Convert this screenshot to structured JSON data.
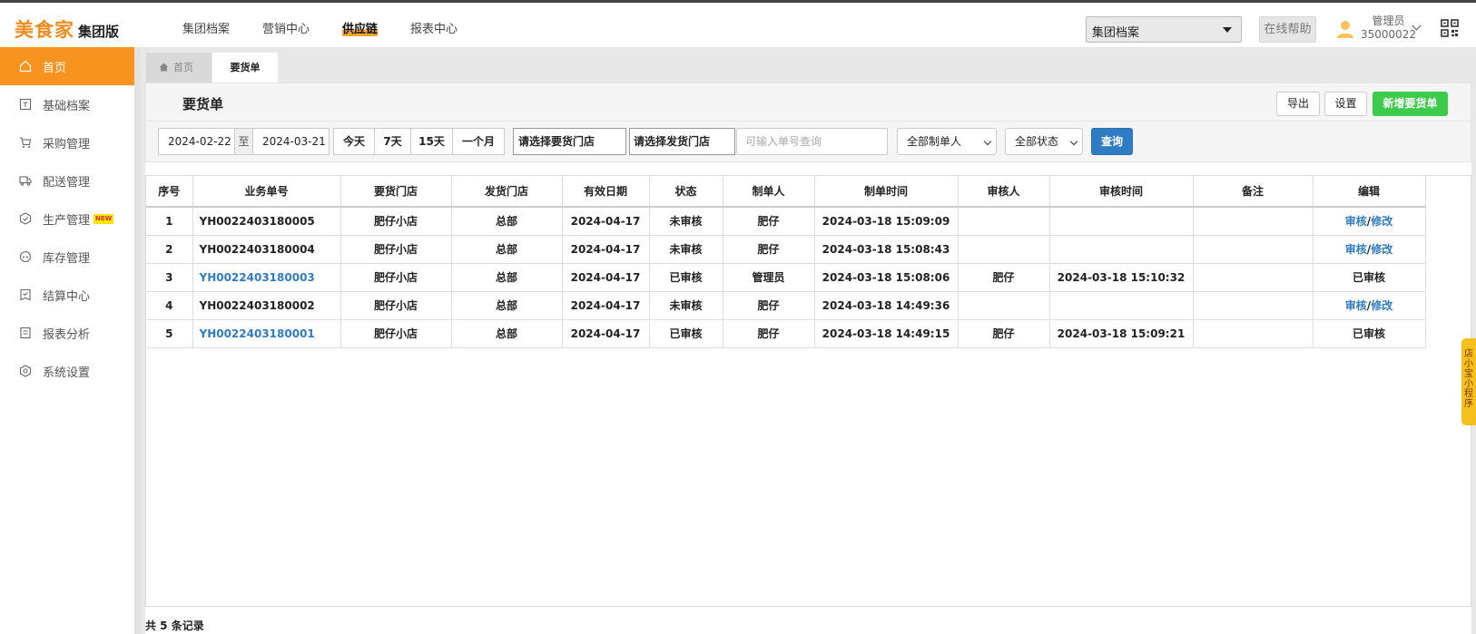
{
  "header": {
    "logo_brand": "美食家",
    "logo_edition": "集团版",
    "nav": [
      "集团档案",
      "营销中心",
      "供应链",
      "报表中心"
    ],
    "nav_active": "供应链",
    "group_select": "集团档案",
    "help": "在线帮助",
    "user_name": "管理员",
    "user_id": "35000022"
  },
  "sidebar": {
    "items": [
      {
        "label": "首页",
        "icon": "home-icon"
      },
      {
        "label": "基础档案",
        "icon": "archive-icon"
      },
      {
        "label": "采购管理",
        "icon": "cart-icon"
      },
      {
        "label": "配送管理",
        "icon": "truck-icon"
      },
      {
        "label": "生产管理",
        "icon": "production-icon",
        "badge": "NEW"
      },
      {
        "label": "库存管理",
        "icon": "warehouse-icon"
      },
      {
        "label": "结算中心",
        "icon": "settlement-icon"
      },
      {
        "label": "报表分析",
        "icon": "report-icon"
      },
      {
        "label": "系统设置",
        "icon": "settings-icon"
      }
    ]
  },
  "tabs": {
    "home": "首页",
    "current": "要货单"
  },
  "page": {
    "title": "要货单",
    "export": "导出",
    "settings": "设置",
    "new_order": "新增要货单"
  },
  "filters": {
    "date_from": "2024-02-22",
    "date_sep": "至",
    "date_to": "2024-03-21",
    "quick": [
      "今天",
      "7天",
      "15天",
      "一个月"
    ],
    "store_select": "请选择要货门店",
    "ship_select": "请选择发货门店",
    "order_placeholder": "可输入单号查询",
    "maker_select": "全部制单人",
    "status_select": "全部状态",
    "query": "查询"
  },
  "table": {
    "columns": [
      "序号",
      "业务单号",
      "要货门店",
      "发货门店",
      "有效日期",
      "状态",
      "制单人",
      "制单时间",
      "审核人",
      "审核时间",
      "备注",
      "编辑"
    ],
    "rows": [
      {
        "no": "1",
        "order": "YH0022403180005",
        "link": false,
        "store": "肥仔小店",
        "ship": "总部",
        "valid": "2024-04-17",
        "status": "未审核",
        "maker": "肥仔",
        "made_at": "2024-03-18 15:09:09",
        "auditor": "",
        "audited_at": "",
        "note": "",
        "edit": "",
        "audit": "审核",
        "modify": "修改"
      },
      {
        "no": "2",
        "order": "YH0022403180004",
        "link": false,
        "store": "肥仔小店",
        "ship": "总部",
        "valid": "2024-04-17",
        "status": "未审核",
        "maker": "肥仔",
        "made_at": "2024-03-18 15:08:43",
        "auditor": "",
        "audited_at": "",
        "note": "",
        "edit": "",
        "audit": "审核",
        "modify": "修改"
      },
      {
        "no": "3",
        "order": "YH0022403180003",
        "link": true,
        "store": "肥仔小店",
        "ship": "总部",
        "valid": "2024-04-17",
        "status": "已审核",
        "maker": "管理员",
        "made_at": "2024-03-18 15:08:06",
        "auditor": "肥仔",
        "audited_at": "2024-03-18 15:10:32",
        "note": "",
        "edit": "已审核",
        "audit": "",
        "modify": ""
      },
      {
        "no": "4",
        "order": "YH0022403180002",
        "link": false,
        "store": "肥仔小店",
        "ship": "总部",
        "valid": "2024-04-17",
        "status": "未审核",
        "maker": "肥仔",
        "made_at": "2024-03-18 14:49:36",
        "auditor": "",
        "audited_at": "",
        "note": "",
        "edit": "",
        "audit": "审核",
        "modify": "修改"
      },
      {
        "no": "5",
        "order": "YH0022403180001",
        "link": true,
        "store": "肥仔小店",
        "ship": "总部",
        "valid": "2024-04-17",
        "status": "已审核",
        "maker": "肥仔",
        "made_at": "2024-03-18 14:49:15",
        "auditor": "肥仔",
        "audited_at": "2024-03-18 15:09:21",
        "note": "",
        "edit": "已审核",
        "audit": "",
        "modify": ""
      }
    ],
    "edit_sep": "/"
  },
  "footer": {
    "count": "共 5 条记录"
  },
  "side_tab": "店小宝小程序",
  "colors": {
    "brand": "#f08c1e",
    "sidebar_active": "#f7931e",
    "primary": "#2f7cc4",
    "success": "#3dcb4c"
  }
}
